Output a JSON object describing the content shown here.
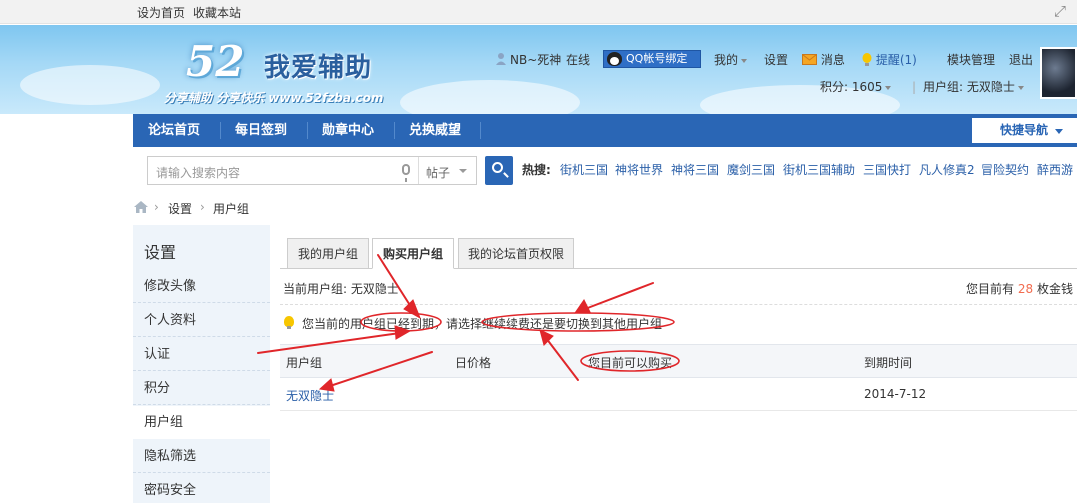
{
  "topbar": {
    "set_home": "设为首页",
    "bookmark": "收藏本站"
  },
  "header": {
    "logo_number": "52",
    "logo_title": "我爱辅助",
    "logo_slogan": "分享辅助 分享快乐 www.52fzba.com",
    "username": "NB~死神",
    "online_status": "在线",
    "qq_bind": "QQ帐号绑定",
    "my": "我的",
    "settings": "设置",
    "messages": "消息",
    "reminders": "提醒(1)",
    "module_manage": "模块管理",
    "logout": "退出",
    "points": "积分: 1605",
    "user_group": "用户组: 无双隐士"
  },
  "nav": {
    "items": [
      "论坛首页",
      "每日签到",
      "勋章中心",
      "兑换威望"
    ],
    "quick_nav": "快捷导航"
  },
  "search": {
    "placeholder": "请输入搜索内容",
    "type": "帖子",
    "hot_label": "热搜:",
    "hot": [
      "街机三国",
      "神将世界",
      "神将三国",
      "魔剑三国",
      "街机三国辅助",
      "三国快打",
      "凡人修真2",
      "冒险契约",
      "醉西游"
    ]
  },
  "breadcrumb": [
    "设置",
    "用户组"
  ],
  "sidebar": {
    "title": "设置",
    "items": [
      "修改头像",
      "个人资料",
      "认证",
      "积分",
      "用户组",
      "隐私筛选",
      "密码安全"
    ],
    "active": "用户组"
  },
  "tabs": [
    "我的用户组",
    "购买用户组",
    "我的论坛首页权限"
  ],
  "active_tab": "购买用户组",
  "main": {
    "current_group": "当前用户组: 无双隐士",
    "coins_prefix": "您目前有",
    "coins_value": "28",
    "coins_suffix": "枚金钱",
    "notice": "您当前的用户组已经到期，请选择继续续费还是要切换到其他用户组",
    "columns": [
      "用户组",
      "日价格",
      "您目前可以购买",
      "到期时间"
    ],
    "rows": [
      {
        "group": "无双隐士",
        "price": "",
        "buyable": "",
        "expiry": "2014-7-12"
      }
    ]
  },
  "colors": {
    "nav_blue": "#2a66b5",
    "link_blue": "#2a5fa8",
    "coin_orange": "#f26c4f",
    "annotation_red": "#e0262a"
  }
}
